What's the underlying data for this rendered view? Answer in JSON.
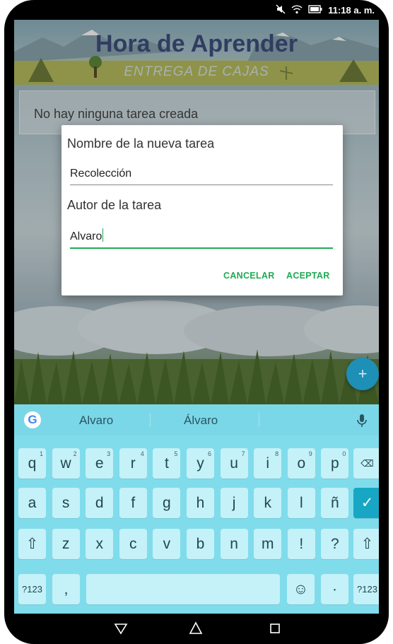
{
  "status_bar": {
    "time": "11:18 a. m."
  },
  "app": {
    "title": "Hora de Aprender",
    "subtitle": "ENTREGA DE CAJAS",
    "empty_message": "No hay ninguna tarea creada",
    "fab_icon": "+"
  },
  "dialog": {
    "name_label": "Nombre de la nueva tarea",
    "name_value": "Recolección",
    "author_label": "Autor de la tarea",
    "author_value": "Alvaro",
    "cancel_label": "CANCELAR",
    "accept_label": "ACEPTAR",
    "accent_color": "#1faa54"
  },
  "keyboard": {
    "suggestions": [
      "Alvaro",
      "Álvaro"
    ],
    "row1": [
      {
        "key": "q",
        "hint": "1"
      },
      {
        "key": "w",
        "hint": "2"
      },
      {
        "key": "e",
        "hint": "3"
      },
      {
        "key": "r",
        "hint": "4"
      },
      {
        "key": "t",
        "hint": "5"
      },
      {
        "key": "y",
        "hint": "6"
      },
      {
        "key": "u",
        "hint": "7"
      },
      {
        "key": "i",
        "hint": "8"
      },
      {
        "key": "o",
        "hint": "9"
      },
      {
        "key": "p",
        "hint": "0"
      }
    ],
    "row2": [
      "a",
      "s",
      "d",
      "f",
      "g",
      "h",
      "j",
      "k",
      "l",
      "ñ"
    ],
    "row3": [
      "z",
      "x",
      "c",
      "v",
      "b",
      "n",
      "m",
      "!",
      "?"
    ],
    "symbols_label": "?123",
    "comma": ",",
    "period": "·",
    "shift_icon": "⇧",
    "backspace_icon": "⌫",
    "enter_icon": "✓",
    "emoji_icon": "☺",
    "colors": {
      "background": "#80dceb",
      "key": "#c5f1f8",
      "action": "#17a7c5"
    }
  },
  "nav_bar": {
    "back_icon": "back-triangle",
    "home_icon": "home",
    "recents_icon": "square"
  }
}
